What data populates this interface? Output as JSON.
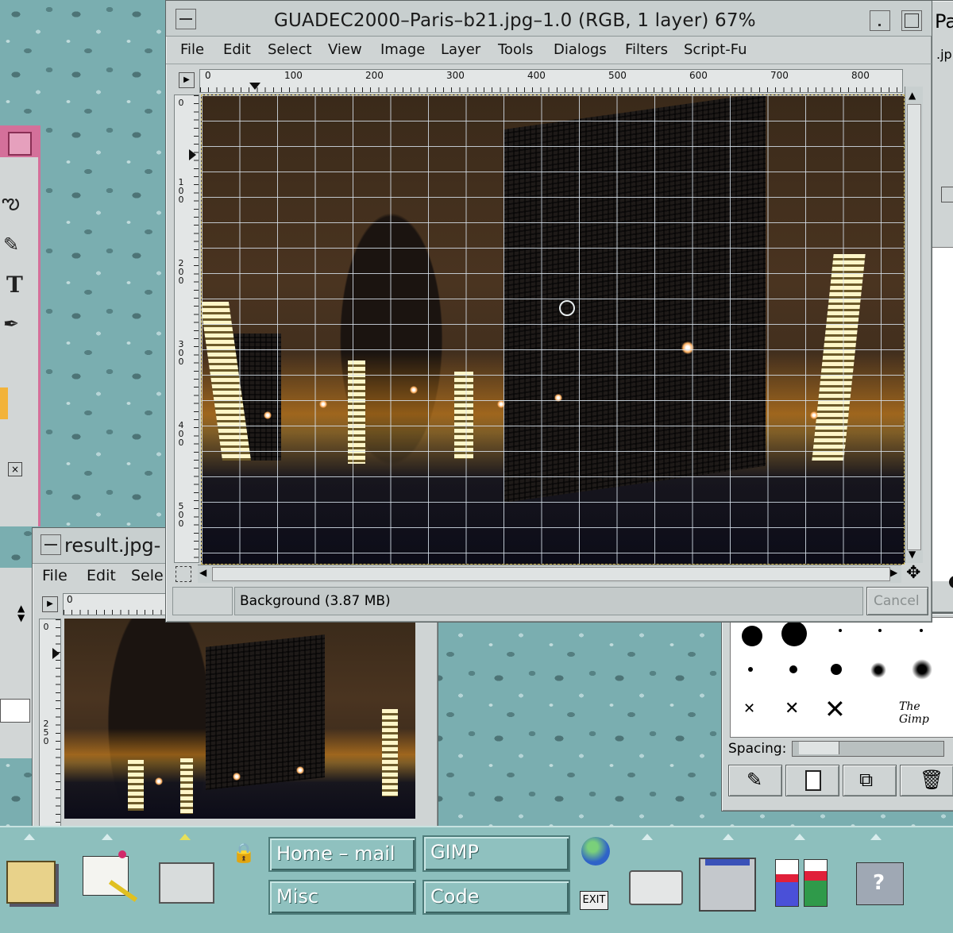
{
  "main_window": {
    "title": "GUADEC2000–Paris–b21.jpg–1.0 (RGB, 1 layer) 67%",
    "menu": [
      "File",
      "Edit",
      "Select",
      "View",
      "Image",
      "Layer",
      "Tools",
      "Dialogs",
      "Filters",
      "Script-Fu"
    ],
    "h_ruler_labels": [
      "0",
      "100",
      "200",
      "300",
      "400",
      "500",
      "600",
      "700",
      "800"
    ],
    "v_ruler_labels": [
      "0",
      "1 0 0",
      "2 0 0",
      "3 0 0",
      "4 0 0",
      "5 0 0"
    ],
    "status_text": "Background (3.87 MB)",
    "cancel_label": "Cancel"
  },
  "result_window": {
    "title": "result.jpg-",
    "menu": [
      "File",
      "Edit",
      "Sele"
    ],
    "h_ruler_label": "0",
    "v_ruler_labels": [
      "0",
      "2 5 0"
    ]
  },
  "partial_window": {
    "title": "Pa",
    "text": ".jp"
  },
  "brushes": {
    "spacing_label": "Spacing:",
    "logo_text": "The Gimp"
  },
  "panel": {
    "buttons": [
      "Home – mail",
      "GIMP",
      "Misc",
      "Code"
    ],
    "exit_label": "EXIT"
  },
  "colors": {
    "desktop": "#7aaeb0",
    "window_bg": "#cfd4d4",
    "panel_bg": "#8fc1bf",
    "pink_border": "#d4709a"
  }
}
